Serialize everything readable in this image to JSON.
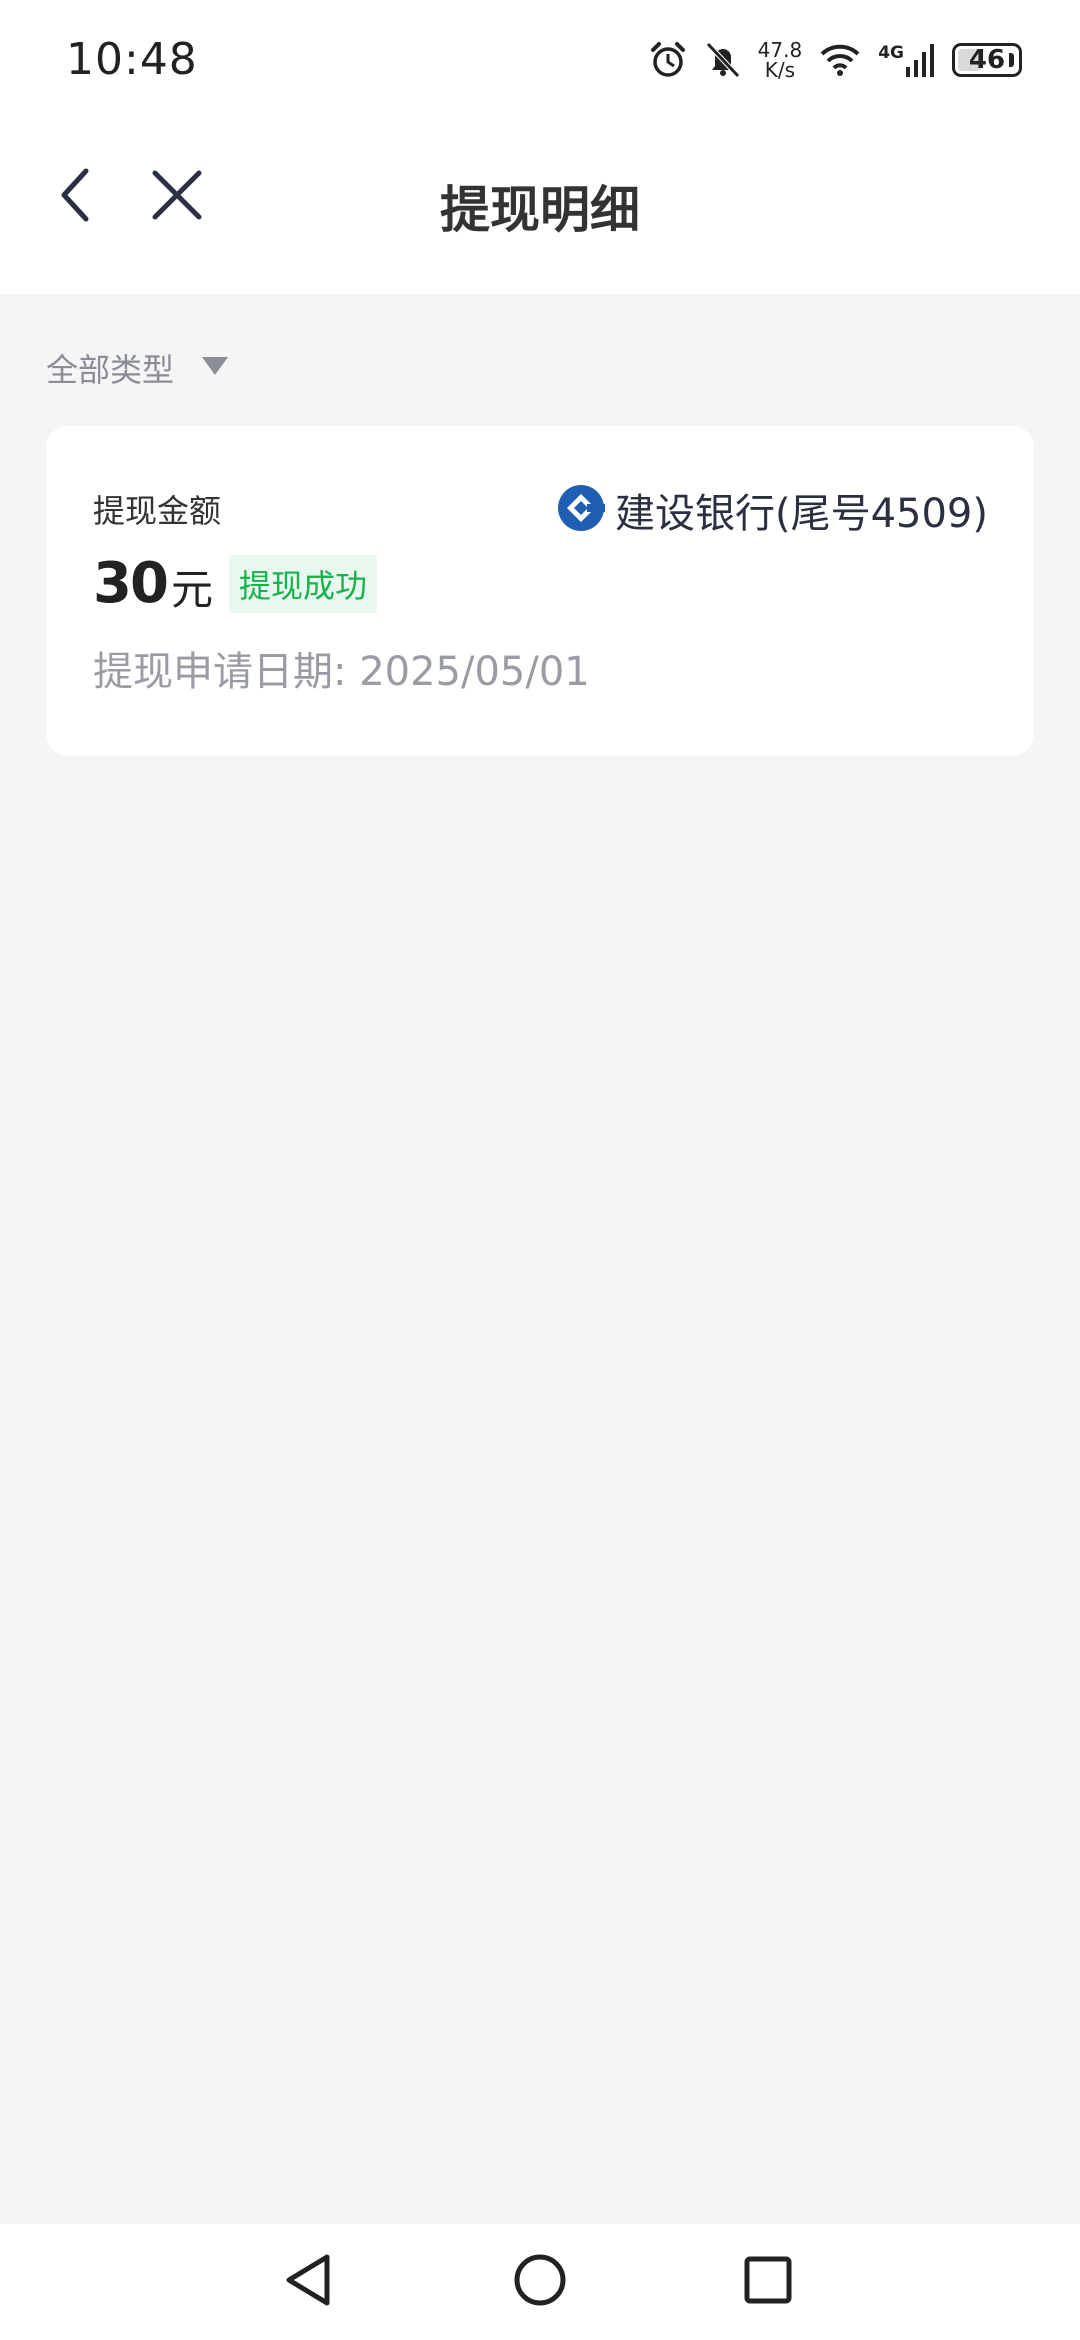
{
  "status_bar": {
    "time": "10:48",
    "net_speed_value": "47.8",
    "net_speed_unit": "K/s",
    "network": "4G",
    "battery": "46",
    "battery_level_percent": 46
  },
  "header": {
    "title": "提现明细"
  },
  "filter": {
    "label": "全部类型"
  },
  "record": {
    "amount_label": "提现金额",
    "bank_name": "建设银行(尾号4509)",
    "amount": "30",
    "unit": "元",
    "status": "提现成功",
    "date_label": "提现申请日期",
    "date_sep": ":",
    "date_value": "2025/05/01"
  },
  "colors": {
    "background": "#f5f5f6",
    "card": "#ffffff",
    "success_text": "#19b24c",
    "success_bg": "#e9f8ee",
    "bank_logo": "#1f5fb3",
    "secondary_text": "#9a9ca3"
  },
  "icons": {
    "back": "chevron-left-icon",
    "close": "close-icon",
    "filter": "caret-down-icon",
    "bank_logo": "ccb-logo-icon",
    "nav_back": "triangle-back-icon",
    "nav_home": "circle-home-icon",
    "nav_recent": "square-recent-icon"
  }
}
